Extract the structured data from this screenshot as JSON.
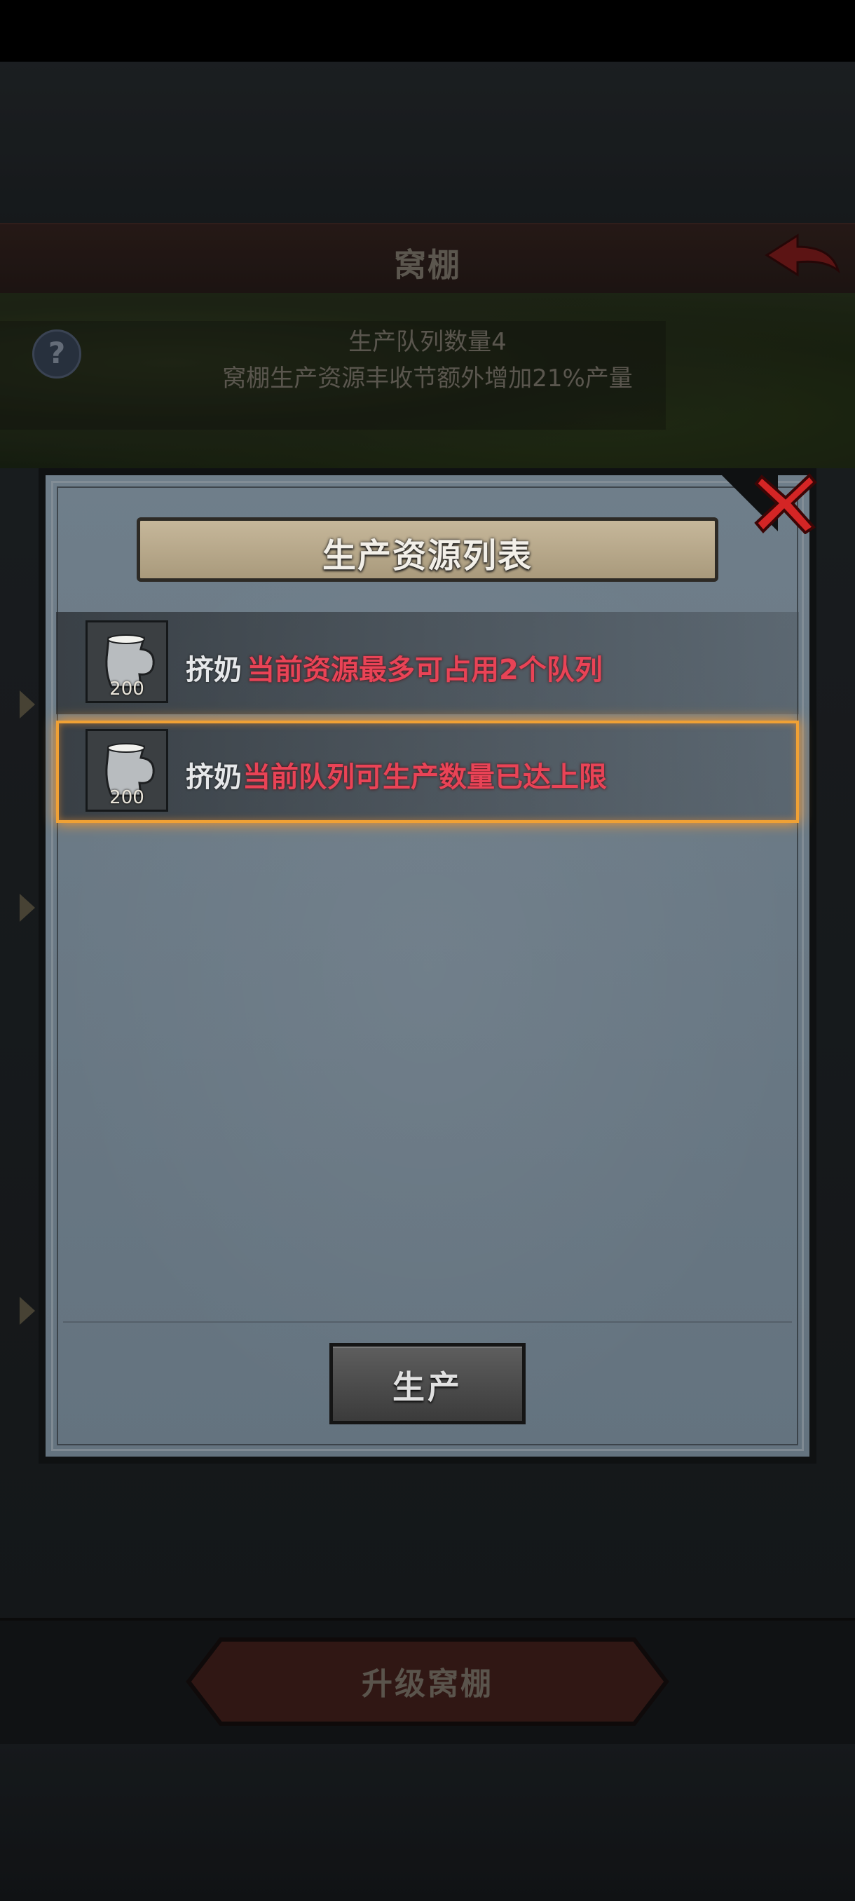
{
  "screen": {
    "header_title": "窝棚",
    "banner_line1": "生产队列数量4",
    "banner_line2": "窝棚生产资源丰收节额外增加21%产量",
    "upgrade_label": "升级窝棚"
  },
  "dialog": {
    "title": "生产资源列表",
    "items": [
      {
        "name": "挤奶",
        "badge": "200",
        "message": "当前资源最多可占用2个队列",
        "icon": "milk-jug-icon",
        "selected": false
      },
      {
        "name": "挤奶",
        "badge": "200",
        "message": "当前队列可生产数量已达上限",
        "icon": "milk-jug-icon",
        "selected": true
      }
    ],
    "produce_label": "生产",
    "close_icon": "close-x-icon"
  },
  "colors": {
    "warning_text": "#e94356",
    "selection_border": "#f0a135",
    "close_red": "#d42525"
  }
}
